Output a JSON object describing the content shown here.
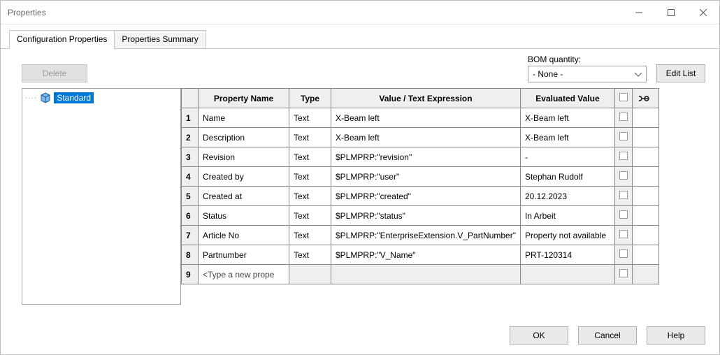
{
  "window": {
    "title": "Properties"
  },
  "tabs": {
    "config": "Configuration Properties",
    "summary": "Properties Summary"
  },
  "toolbar": {
    "delete": "Delete",
    "bom_label": "BOM quantity:",
    "bom_value": "- None -",
    "edit_list": "Edit List"
  },
  "tree": {
    "root": "Standard"
  },
  "grid": {
    "headers": {
      "name": "Property Name",
      "type": "Type",
      "expr": "Value / Text Expression",
      "eval": "Evaluated Value"
    },
    "rows": [
      {
        "n": "1",
        "name": "Name",
        "type": "Text",
        "expr": "X-Beam left",
        "eval": "X-Beam left"
      },
      {
        "n": "2",
        "name": "Description",
        "type": "Text",
        "expr": "X-Beam left",
        "eval": "X-Beam left"
      },
      {
        "n": "3",
        "name": "Revision",
        "type": "Text",
        "expr": "$PLMPRP:\"revision\"",
        "eval": "-"
      },
      {
        "n": "4",
        "name": "Created by",
        "type": "Text",
        "expr": "$PLMPRP:\"user\"",
        "eval": "Stephan Rudolf"
      },
      {
        "n": "5",
        "name": "Created at",
        "type": "Text",
        "expr": "$PLMPRP:\"created\"",
        "eval": "20.12.2023"
      },
      {
        "n": "6",
        "name": "Status",
        "type": "Text",
        "expr": "$PLMPRP:\"status\"",
        "eval": "In Arbeit"
      },
      {
        "n": "7",
        "name": "Article No",
        "type": "Text",
        "expr": "$PLMPRP:\"EnterpriseExtension.V_PartNumber\"",
        "eval": "Property not available"
      },
      {
        "n": "8",
        "name": "Partnumber",
        "type": "Text",
        "expr": "$PLMPRP:\"V_Name\"",
        "eval": "PRT-120314"
      }
    ],
    "new_row": {
      "n": "9",
      "placeholder": "<Type a new prope"
    }
  },
  "footer": {
    "ok": "OK",
    "cancel": "Cancel",
    "help": "Help"
  }
}
